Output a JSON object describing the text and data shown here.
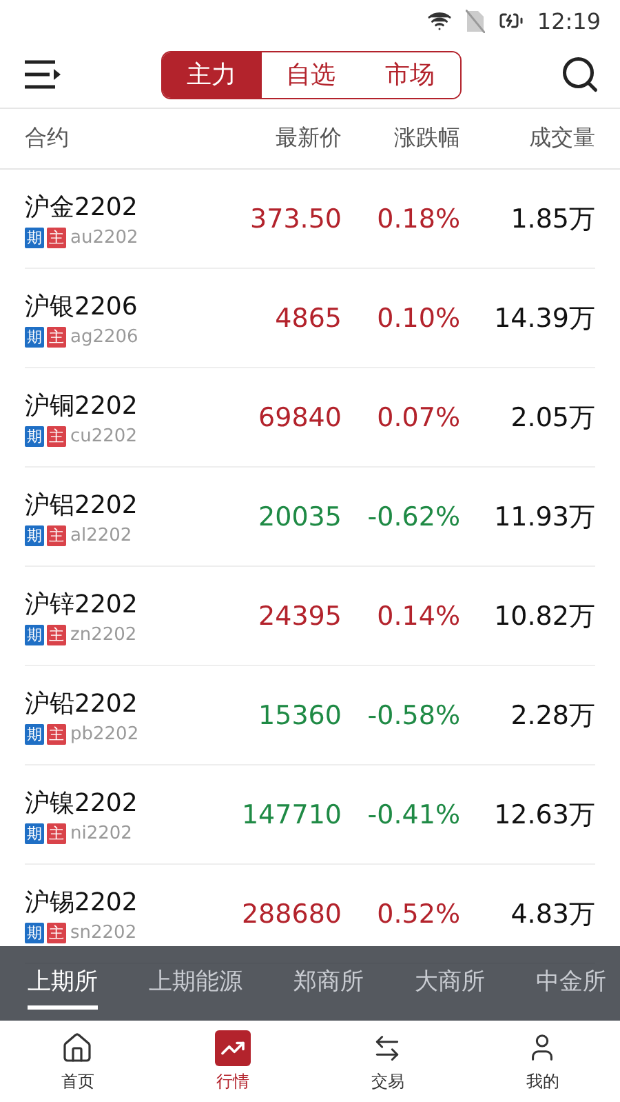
{
  "status_bar": {
    "time": "12:19"
  },
  "segment_tabs": [
    {
      "label": "主力",
      "selected": true
    },
    {
      "label": "自选",
      "selected": false
    },
    {
      "label": "市场",
      "selected": false
    }
  ],
  "columns": [
    "合约",
    "最新价",
    "涨跌幅",
    "成交量"
  ],
  "rows": [
    {
      "name": "沪金2202",
      "tags": [
        {
          "text": "期",
          "color": "#1f6fc5"
        },
        {
          "text": "主",
          "color": "#d9434a"
        }
      ],
      "code": "au2202",
      "price": "373.50",
      "change": "0.18%",
      "volume": "1.85万",
      "color": "#b3232c"
    },
    {
      "name": "沪银2206",
      "tags": [
        {
          "text": "期",
          "color": "#1f6fc5"
        },
        {
          "text": "主",
          "color": "#d9434a"
        }
      ],
      "code": "ag2206",
      "price": "4865",
      "change": "0.10%",
      "volume": "14.39万",
      "color": "#b3232c"
    },
    {
      "name": "沪铜2202",
      "tags": [
        {
          "text": "期",
          "color": "#1f6fc5"
        },
        {
          "text": "主",
          "color": "#d9434a"
        }
      ],
      "code": "cu2202",
      "price": "69840",
      "change": "0.07%",
      "volume": "2.05万",
      "color": "#b3232c"
    },
    {
      "name": "沪铝2202",
      "tags": [
        {
          "text": "期",
          "color": "#1f6fc5"
        },
        {
          "text": "主",
          "color": "#d9434a"
        }
      ],
      "code": "al2202",
      "price": "20035",
      "change": "-0.62%",
      "volume": "11.93万",
      "color": "#1f8a45"
    },
    {
      "name": "沪锌2202",
      "tags": [
        {
          "text": "期",
          "color": "#1f6fc5"
        },
        {
          "text": "主",
          "color": "#d9434a"
        }
      ],
      "code": "zn2202",
      "price": "24395",
      "change": "0.14%",
      "volume": "10.82万",
      "color": "#b3232c"
    },
    {
      "name": "沪铅2202",
      "tags": [
        {
          "text": "期",
          "color": "#1f6fc5"
        },
        {
          "text": "主",
          "color": "#d9434a"
        }
      ],
      "code": "pb2202",
      "price": "15360",
      "change": "-0.58%",
      "volume": "2.28万",
      "color": "#1f8a45"
    },
    {
      "name": "沪镍2202",
      "tags": [
        {
          "text": "期",
          "color": "#1f6fc5"
        },
        {
          "text": "主",
          "color": "#d9434a"
        }
      ],
      "code": "ni2202",
      "price": "147710",
      "change": "-0.41%",
      "volume": "12.63万",
      "color": "#1f8a45"
    },
    {
      "name": "沪锡2202",
      "tags": [
        {
          "text": "期",
          "color": "#1f6fc5"
        },
        {
          "text": "主",
          "color": "#d9434a"
        }
      ],
      "code": "sn2202",
      "price": "288680",
      "change": "0.52%",
      "volume": "4.83万",
      "color": "#b3232c"
    }
  ],
  "exchange_tabs": [
    {
      "label": "上期所",
      "selected": true
    },
    {
      "label": "上期能源",
      "selected": false
    },
    {
      "label": "郑商所",
      "selected": false
    },
    {
      "label": "大商所",
      "selected": false
    },
    {
      "label": "中金所",
      "selected": false
    }
  ],
  "bottom_nav": [
    {
      "label": "首页",
      "kind": "home",
      "selected": false
    },
    {
      "label": "行情",
      "kind": "market",
      "selected": true
    },
    {
      "label": "交易",
      "kind": "trade",
      "selected": false
    },
    {
      "label": "我的",
      "kind": "profile",
      "selected": false
    }
  ]
}
